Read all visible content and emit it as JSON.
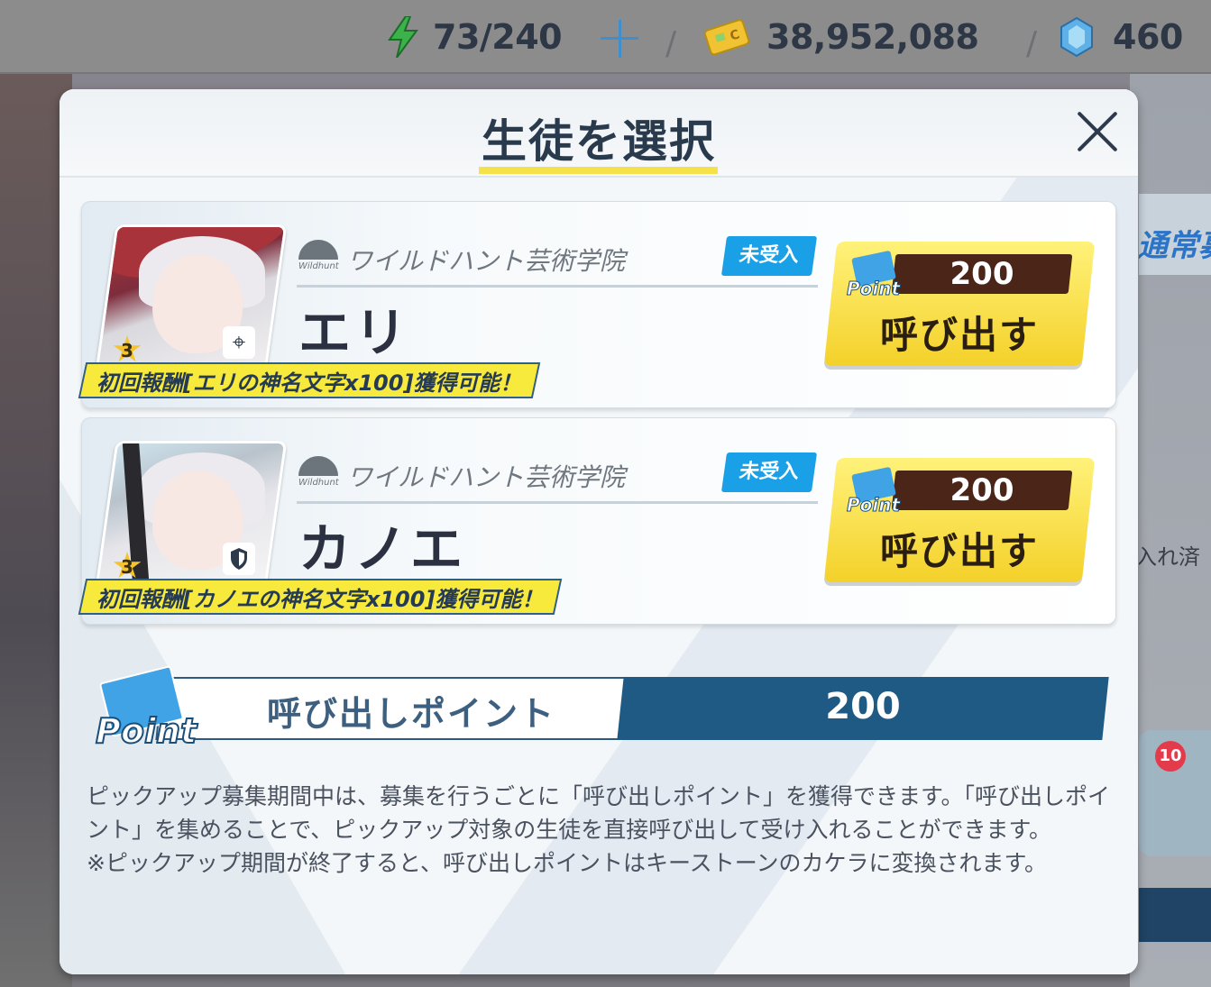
{
  "topbar": {
    "stamina": "73/240",
    "credits": "38,952,088",
    "gems": "460"
  },
  "background": {
    "banner_text": "通常募",
    "right_text": "入れ済",
    "mail_badge": "10"
  },
  "modal": {
    "title": "生徒を選択"
  },
  "students": [
    {
      "school": "ワイルドハント芸術学院",
      "school_logo_text": "Wildhunt",
      "status": "未受入",
      "name": "エリ",
      "stars": "3",
      "role_icon": "crosshair-icon",
      "reward": "初回報酬[エリの神名文字x100]獲得可能！",
      "cost": "200",
      "point_label": "Point",
      "button_label": "呼び出す"
    },
    {
      "school": "ワイルドハント芸術学院",
      "school_logo_text": "Wildhunt",
      "status": "未受入",
      "name": "カノエ",
      "stars": "3",
      "role_icon": "shield-icon",
      "reward": "初回報酬[カノエの神名文字x100]獲得可能！",
      "cost": "200",
      "point_label": "Point",
      "button_label": "呼び出す"
    }
  ],
  "points": {
    "icon_label": "Point",
    "label": "呼び出しポイント",
    "value": "200"
  },
  "description": {
    "line1": "ピックアップ募集期間中は、募集を行うごとに「呼び出しポイント」を獲得できます。「呼び出しポイント」を集めることで、ピックアップ対象の生徒を直接呼び出して受け入れることができます。",
    "line2": "※ピックアップ期間が終了すると、呼び出しポイントはキーストーンのカケラに変換されます。"
  },
  "colors": {
    "accent_yellow": "#f5e24b",
    "status_blue": "#1aa0e6",
    "point_bar_dark": "#1f5a85",
    "title_text": "#2a3a4d"
  }
}
